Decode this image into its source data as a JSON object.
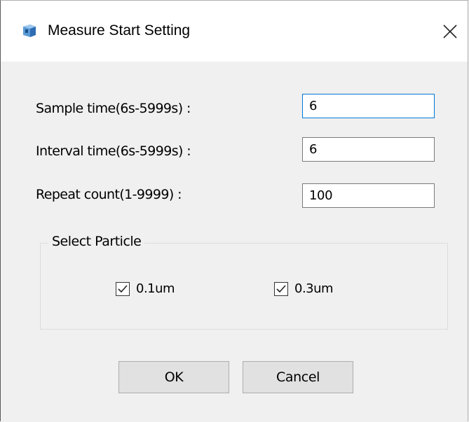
{
  "window": {
    "title": "Measure Start Setting",
    "close_glyph": "✕"
  },
  "fields": [
    {
      "label": "Sample time(6s-5999s) :",
      "value": "6"
    },
    {
      "label": "Interval time(6s-5999s) :",
      "value": "6"
    },
    {
      "label": "Repeat count(1-9999) :",
      "value": "100"
    }
  ],
  "particle_group": {
    "title": "Select Particle",
    "options": [
      {
        "label": "0.1um",
        "checked": true
      },
      {
        "label": "0.3um",
        "checked": true
      }
    ]
  },
  "buttons": {
    "ok": "OK",
    "cancel": "Cancel"
  },
  "colors": {
    "focus_border": "#0078d7",
    "icon_blue": "#2b7cd3"
  }
}
